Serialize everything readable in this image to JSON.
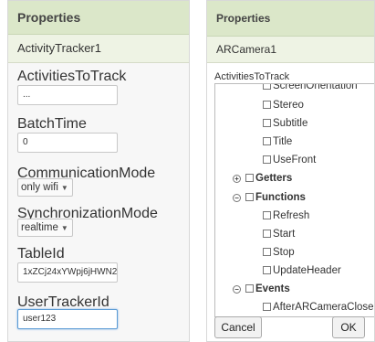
{
  "left": {
    "header": "Properties",
    "component": "ActivityTracker1",
    "activities_label": "ActivitiesToTrack",
    "activities_value": "...",
    "batch_label": "BatchTime",
    "batch_value": "0",
    "communication_label": "CommunicationMode",
    "communication_value": "only wifi",
    "sync_label": "SynchronizationMode",
    "sync_value": "realtime",
    "tableid_label": "TableId",
    "tableid_value": "1xZCj24xYWpj6jHWN2",
    "usertracker_label": "UserTrackerId",
    "usertracker_value": "user123"
  },
  "right": {
    "header": "Properties",
    "component": "ARCamera1",
    "activities_label": "ActivitiesToTrack",
    "tree": {
      "cut_item": "ScreenOrientation",
      "items_a": [
        "Stereo",
        "Subtitle",
        "Title",
        "UseFront"
      ],
      "getters": "Getters",
      "functions": "Functions",
      "functions_items": [
        "Refresh",
        "Start",
        "Stop",
        "UpdateHeader"
      ],
      "events": "Events",
      "events_items": [
        "AfterARCameraClose"
      ]
    },
    "cancel_label": "Cancel",
    "ok_label": "OK"
  },
  "icons": {
    "expand": "plus-circle-icon",
    "collapse": "minus-circle-icon",
    "checkbox": "checkbox-icon",
    "dropdown": "caret-down-icon"
  }
}
